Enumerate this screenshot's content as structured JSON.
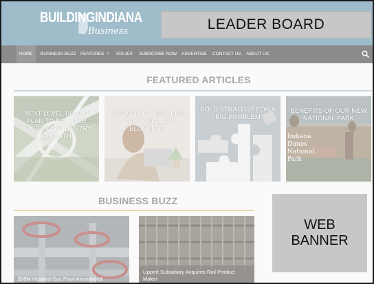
{
  "header": {
    "logo_main": "BUILDINGINDIANA",
    "logo_script": "Business",
    "leader_board": "LEADER BOARD"
  },
  "nav": {
    "items": [
      "HOME",
      "BUSINESS BUZZ",
      "FEATURES",
      "ISSUES",
      "SUBSCRIBE NOW",
      "ADVERTISE",
      "CONTACT US",
      "ABOUT US"
    ],
    "features_caret": "˅",
    "active_item": "HOME",
    "search_icon": "search-icon"
  },
  "featured": {
    "title": "FEATURED ARTICLES",
    "cards": [
      {
        "title": "'NEXT LEVEL ROADS' PLAN TO BOLSTER LOGISTICS INDUSTRY GROWTH"
      },
      {
        "title": "MARKETING MISTAKES – TOP 5 BIGGEST BLUNDERS"
      },
      {
        "title": "BOLD STRATEGY FOR A BIG PROBLEM"
      },
      {
        "title": "BENEFITS OF OUR NEW NATIONAL PARK",
        "sign_text": "Indiana Dunes National Park"
      }
    ]
  },
  "buzz": {
    "title": "BUSINESS BUZZ",
    "cards": [
      {
        "caption": "$38M Hospital Gas Plant Announced"
      },
      {
        "caption": "Lippert Subsidiary Acquires Rail Product Maker"
      }
    ]
  },
  "web_banner": {
    "line1": "WEB",
    "line2": "BANNER"
  },
  "colors": {
    "header_bg": "#9fbccb",
    "nav_bg": "#8b8b8b",
    "ad_placeholder": "#c7c7c7",
    "section_title": "#a8a8a8",
    "section_rule_blue": "#c8d5de",
    "section_rule_gold": "#e6d9ac"
  }
}
